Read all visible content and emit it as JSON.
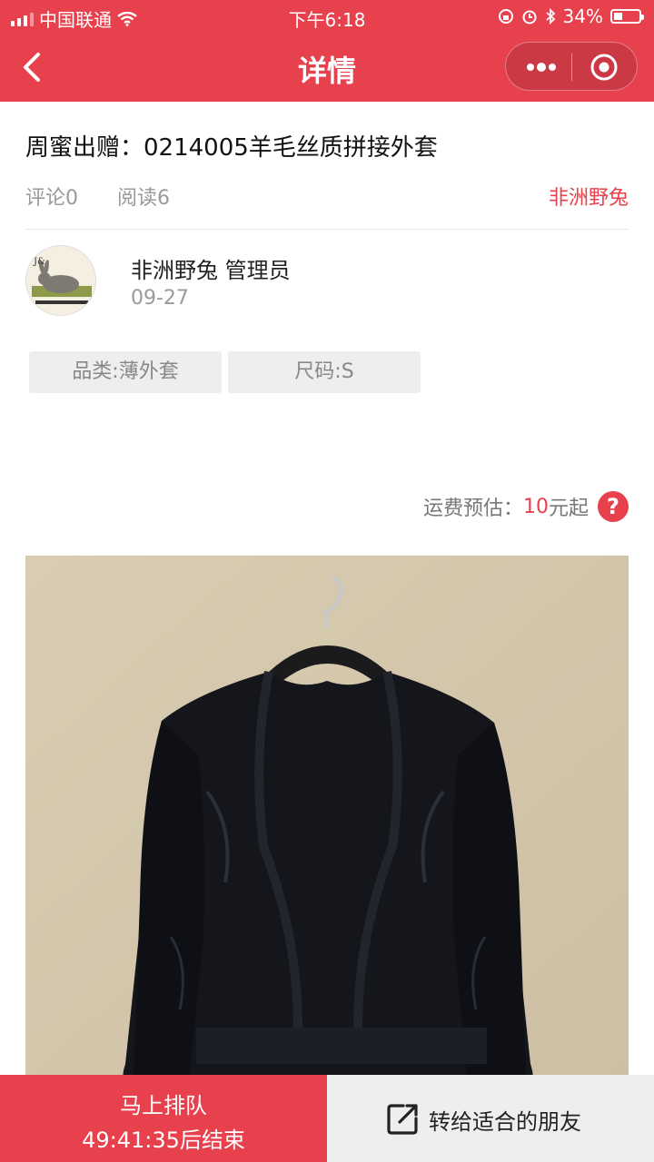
{
  "status_bar": {
    "carrier": "中国联通",
    "time": "下午6:18",
    "battery": "34%"
  },
  "nav": {
    "title": "详情"
  },
  "post": {
    "title": "周蜜出赠：0214005羊毛丝质拼接外套",
    "comments": "评论0",
    "reads": "阅读6",
    "author_link": "非洲野兔"
  },
  "author": {
    "name": "非洲野兔 管理员",
    "date": "09-27"
  },
  "tags": [
    "品类:薄外套",
    "尺码:S"
  ],
  "shipping": {
    "label": "运费预估：",
    "price": "10",
    "suffix": "元起",
    "help_icon": "?"
  },
  "bottom": {
    "queue_line1": "马上排队",
    "queue_line2": "49:41:35后结束",
    "share_label": "转给适合的朋友"
  },
  "colors": {
    "accent": "#e8414e",
    "button_gray": "#eeeeee"
  },
  "icons": [
    "back-icon",
    "more-dots-icon",
    "target-icon",
    "help-icon",
    "share-icon",
    "wifi-icon",
    "alarm-icon",
    "bluetooth-icon",
    "battery-icon"
  ]
}
